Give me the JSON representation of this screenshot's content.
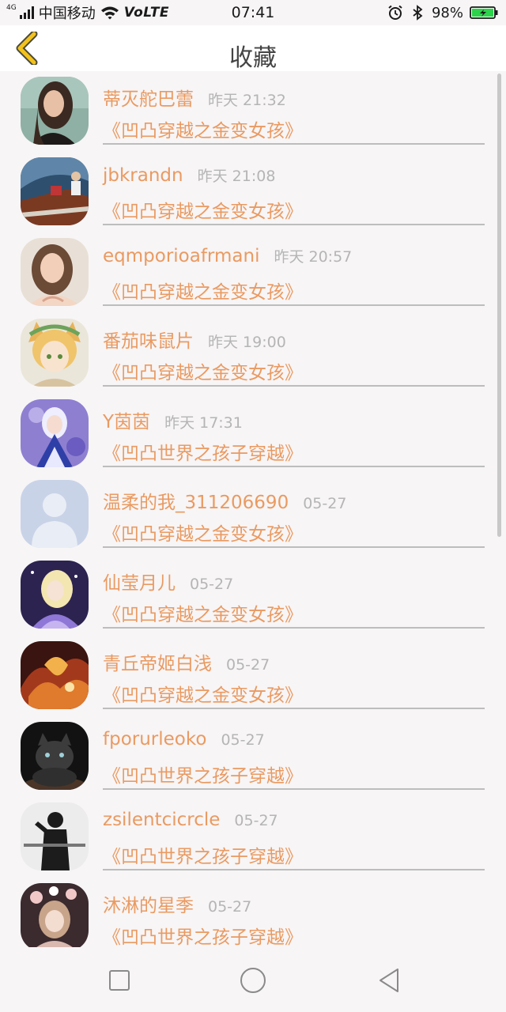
{
  "status_bar": {
    "network_tag": "4G",
    "carrier": "中国移动",
    "volte": "VoLTE",
    "time": "07:41",
    "battery": "98%",
    "icons": [
      "signal-icon",
      "wifi-icon",
      "alarm-icon",
      "bluetooth-icon",
      "battery-icon"
    ],
    "battery_level": 0.98
  },
  "header": {
    "title": "收藏",
    "back_icon": "chevron-left-icon",
    "accent_color": "#f4c21a"
  },
  "colors": {
    "name_text": "#ea9a61",
    "time_text": "#b5b5b5",
    "divider": "#bdbdbd",
    "background": "#f7f5f6"
  },
  "favorites": [
    {
      "name": "蒂灭舵巴蕾",
      "time": "昨天 21:32",
      "book": "《凹凸穿越之金变女孩》",
      "avatar": "portrait-woman-dark-hair"
    },
    {
      "name": "jbkrandn",
      "time": "昨天 21:08",
      "book": "《凹凸穿越之金变女孩》",
      "avatar": "boat-photo"
    },
    {
      "name": "eqmporioafrmani",
      "time": "昨天 20:57",
      "book": "《凹凸穿越之金变女孩》",
      "avatar": "portrait-woman-light"
    },
    {
      "name": "番茄味鼠片",
      "time": "昨天 19:00",
      "book": "《凹凸穿越之金变女孩》",
      "avatar": "anime-fox-girl"
    },
    {
      "name": "Y茵茵",
      "time": "昨天 17:31",
      "book": "《凹凸世界之孩子穿越》",
      "avatar": "anime-blue-dress-girl"
    },
    {
      "name": "温柔的我_311206690",
      "time": "05-27",
      "book": "《凹凸穿越之金变女孩》",
      "avatar": "default-user"
    },
    {
      "name": "仙莹月儿",
      "time": "05-27",
      "book": "《凹凸穿越之金变女孩》",
      "avatar": "anime-purple-girl"
    },
    {
      "name": "青丘帝姬白浅",
      "time": "05-27",
      "book": "《凹凸穿越之金变女孩》",
      "avatar": "fiery-art"
    },
    {
      "name": "fporurleoko",
      "time": "05-27",
      "book": "《凹凸世界之孩子穿越》",
      "avatar": "black-cat"
    },
    {
      "name": "zsilentcicrcle",
      "time": "05-27",
      "book": "《凹凸世界之孩子穿越》",
      "avatar": "silhouette-person"
    },
    {
      "name": "沐淋的星季",
      "time": "05-27",
      "book": "《凹凸世界之孩子穿越》",
      "avatar": "anime-flower-girl"
    }
  ],
  "nav_bar": {
    "recent_icon": "square-icon",
    "home_icon": "circle-icon",
    "back_icon": "triangle-back-icon"
  }
}
